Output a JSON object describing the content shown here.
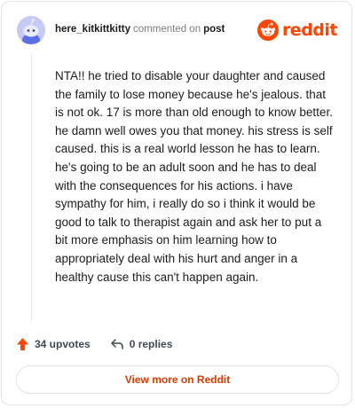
{
  "comment": {
    "username": "here_kitkittkitty",
    "action_text": "commented on",
    "post_label": "post",
    "body": "NTA!! he tried to disable your daughter and caused the family to lose money because he's jealous. that is not ok. 17 is more than old enough to know better. he damn well owes you that money. his stress is self caused. this is a real world lesson he has to learn. he's going to be an adult soon and he has to deal with the consequences for his actions. i have sympathy for him, i really do so i think it would be good to talk to therapist again and ask her to put a bit more emphasis on him learning how to appropriately deal with his hurt and anger in a healthy cause this can't happen again."
  },
  "brand": {
    "name": "reddit",
    "color": "#ff4500"
  },
  "actions": {
    "upvotes_label": "34 upvotes",
    "replies_label": "0 replies"
  },
  "footer": {
    "view_more_label": "View more on Reddit"
  },
  "icons": {
    "avatar": "snoo-avatar-icon",
    "brand": "reddit-logo-icon",
    "upvote": "upvote-arrow-icon",
    "reply": "reply-arrow-icon"
  }
}
